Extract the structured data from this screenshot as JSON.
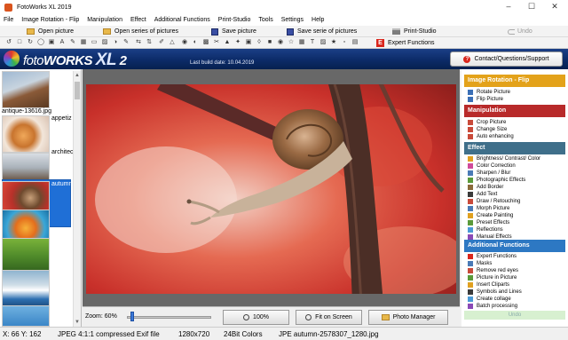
{
  "window": {
    "title": "FotoWorks XL 2019"
  },
  "menu": [
    "File",
    "Image Rotation - Flip",
    "Manipulation",
    "Effect",
    "Additional Functions",
    "Print-Studio",
    "Tools",
    "Settings",
    "Help"
  ],
  "toolbar": {
    "open_picture": "Open picture",
    "open_series": "Open series of pictures",
    "save_picture": "Save picture",
    "save_series": "Save serie of pictures",
    "print_studio": "Print-Studio",
    "undo": "Undo",
    "expert_functions": "Expert Functions"
  },
  "banner": {
    "brand_part1": "foto",
    "brand_part2": "WORKS",
    "brand_part3": "XL",
    "brand_part4": "2",
    "build": "Last build date: 10.04.2019",
    "contact": "Contact/Questions/Support"
  },
  "thumbnails": [
    {
      "label": "antique-13616.jpg",
      "selected": false
    },
    {
      "label": "appetiz",
      "selected": false
    },
    {
      "label": "architec",
      "selected": false
    },
    {
      "label": "autumn",
      "selected": true
    },
    {
      "label": "",
      "selected": false
    },
    {
      "label": "",
      "selected": false
    },
    {
      "label": "",
      "selected": false
    },
    {
      "label": "",
      "selected": false
    }
  ],
  "viewer": {
    "zoom_label": "Zoom: 60%",
    "zoom_value": 60,
    "btn_100": "100%",
    "btn_fit": "Fit on Screen",
    "btn_manager": "Photo Manager"
  },
  "side": {
    "rotation": {
      "title": "Image Rotation - Flip",
      "color": "#e3a21a",
      "items": [
        "Rotate Picture",
        "Flip Picture"
      ]
    },
    "manipulation": {
      "title": "Manipulation",
      "color": "#b82a2a",
      "items": [
        "Crop Picture",
        "Change Size",
        "Auto enhancing"
      ]
    },
    "effect": {
      "title": "Effect",
      "color": "#3f6f8a",
      "items": [
        "Brightness/ Contrast/ Color",
        "Color Correction",
        "Sharpen / Blur",
        "Photographic Effects",
        "Add Border",
        "Add Text",
        "Draw / Retouching",
        "Morph Picture",
        "Create Painting",
        "Preset Effects",
        "Reflections",
        "Manual Effects"
      ]
    },
    "additional": {
      "title": "Additional Functions",
      "color": "#2d78c3",
      "items": [
        "Expert Functions",
        "Masks",
        "Remove red eyes",
        "Picture in Picture",
        "Insert Cliparts",
        "Symbols and Lines",
        "Create collage",
        "Batch processing"
      ]
    },
    "undo": "Undo"
  },
  "status": {
    "coords": "X: 66 Y: 162",
    "format": "JPEG 4:1:1 compressed Exif file",
    "size": "1280x720",
    "colors": "24Bit Colors",
    "file": "JPE autumn-2578307_1280.jpg"
  }
}
